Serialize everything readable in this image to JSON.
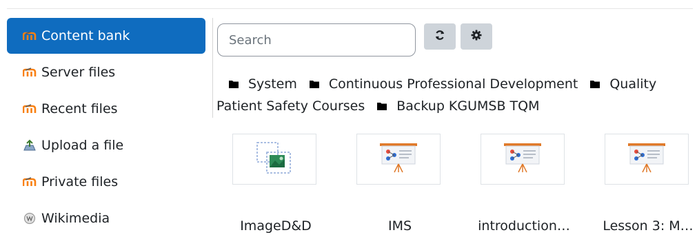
{
  "sidebar": {
    "items": [
      {
        "label": "Content bank",
        "icon": "moodle-icon",
        "active": true
      },
      {
        "label": "Server files",
        "icon": "moodle-icon"
      },
      {
        "label": "Recent files",
        "icon": "moodle-icon"
      },
      {
        "label": "Upload a file",
        "icon": "upload-icon"
      },
      {
        "label": "Private files",
        "icon": "moodle-icon"
      },
      {
        "label": "Wikimedia",
        "icon": "wikimedia-icon"
      }
    ]
  },
  "toolbar": {
    "search_placeholder": "Search",
    "search_value": "",
    "refresh_icon": "refresh-icon",
    "settings_icon": "gear-icon"
  },
  "breadcrumb": [
    "System",
    "Continuous Professional Development",
    "Quality",
    "Patient Safety Courses",
    "Backup KGUMSB TQM"
  ],
  "files": [
    {
      "name": "ImageD&D",
      "icon": "image-file-icon"
    },
    {
      "name": "IMS",
      "icon": "presentation-icon"
    },
    {
      "name": "introduction…",
      "icon": "presentation-icon"
    },
    {
      "name": "Lesson 3: M…",
      "icon": "presentation-icon"
    }
  ],
  "colors": {
    "active_bg": "#0f6cbf",
    "moodle_orange": "#f98012",
    "button_bg": "#ced4da"
  }
}
